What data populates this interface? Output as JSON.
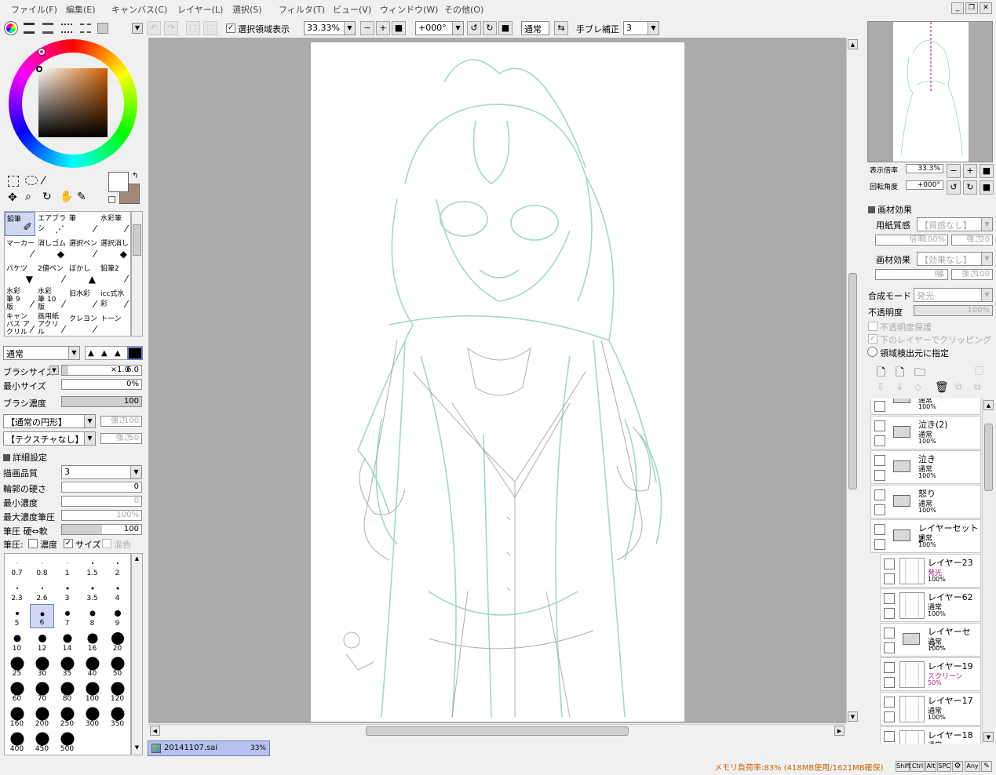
{
  "menu": [
    "ファイル(F)",
    "編集(E)",
    "キャンバス(C)",
    "レイヤー(L)",
    "選択(S)",
    "フィルタ(T)",
    "ビュー(V)",
    "ウィンドウ(W)",
    "その他(O)"
  ],
  "toolbar": {
    "selection_display_label": "選択領域表示",
    "zoom_value": "33.33%",
    "rotation_value": "+000°",
    "blend_mode": "通常",
    "stabilizer_label": "手ブレ補正",
    "stabilizer_value": "3"
  },
  "tools": {
    "row1": [
      "鉛筆",
      "エアブラシ",
      "筆",
      "水彩筆"
    ],
    "row2": [
      "マーカー",
      "消しゴム",
      "選択ペン",
      "選択消し"
    ],
    "row3": [
      "バケツ",
      "2値ペン",
      "ぼかし",
      "鉛筆2"
    ],
    "row4": [
      "水彩筆 9版",
      "水彩筆 10版",
      "旧水彩",
      "icc式水彩"
    ],
    "row5": [
      "キャンバス アクリル",
      "画用紙 アクリル",
      "クレヨン",
      "トーン"
    ]
  },
  "brush": {
    "mode": "通常",
    "size_label": "ブラシサイズ",
    "size_mult": "×1.0",
    "size_value": "6.0",
    "min_size_label": "最小サイズ",
    "min_size_value": "0%",
    "density_label": "ブラシ濃度",
    "density_value": "100",
    "shape": "【通常の円形】",
    "shape_strength_label": "強さ",
    "shape_strength_value": "100",
    "texture": "【テクスチャなし】",
    "texture_strength_label": "強さ",
    "texture_strength_value": "50"
  },
  "details": {
    "header": "詳細設定",
    "quality_label": "描画品質",
    "quality_value": "3",
    "edge_label": "輪郭の硬さ",
    "edge_value": "0",
    "min_density_label": "最小濃度",
    "min_density_value": "0",
    "max_density_pressure_label": "最大濃度筆圧",
    "max_density_pressure_value": "100%",
    "pressure_label": "筆圧 硬⇔軟",
    "pressure_value": "100",
    "pressure_row_label": "筆圧:",
    "pressure_density": "濃度",
    "pressure_size": "サイズ",
    "pressure_blend": "混色"
  },
  "brush_sizes": [
    "0.7",
    "0.8",
    "1",
    "1.5",
    "2",
    "2.3",
    "2.6",
    "3",
    "3.5",
    "4",
    "5",
    "6",
    "7",
    "8",
    "9",
    "10",
    "12",
    "14",
    "16",
    "20",
    "25",
    "30",
    "35",
    "40",
    "50",
    "60",
    "70",
    "80",
    "100",
    "120",
    "160",
    "200",
    "250",
    "300",
    "350",
    "400",
    "450",
    "500"
  ],
  "selected_brush_size": "6",
  "document_tab": {
    "name": "20141107.sai",
    "zoom": "33%"
  },
  "navigator": {
    "zoom_label": "表示倍率",
    "zoom_value": "33.3%",
    "rotate_label": "回転角度",
    "rotate_value": "+000°"
  },
  "material": {
    "header": "画材効果",
    "paper_label": "用紙質感",
    "paper_value": "【質感なし】",
    "magnif_label": "倍率",
    "magnif_value": "100%",
    "paper_strength_label": "強さ",
    "paper_strength_value": "20",
    "effect_label": "画材効果",
    "effect_value": "【効果なし】",
    "width_label": "幅",
    "width_value": "1",
    "effect_strength_label": "強さ",
    "effect_strength_value": "100"
  },
  "layer_props": {
    "blend_label": "合成モード",
    "blend_value": "発光",
    "opacity_label": "不透明度",
    "opacity_value": "100%",
    "protect_label": "不透明度保護",
    "clip_label": "下のレイヤーでクリッピング",
    "source_label": "領域検出元に指定"
  },
  "layers": [
    {
      "name": "",
      "mode": "通常",
      "opacity": "100%",
      "type": "folder",
      "indent": false
    },
    {
      "name": "泣き(2)",
      "mode": "通常",
      "opacity": "100%",
      "type": "folder",
      "indent": false
    },
    {
      "name": "泣き",
      "mode": "通常",
      "opacity": "100%",
      "type": "folder",
      "indent": false
    },
    {
      "name": "怒り",
      "mode": "通常",
      "opacity": "100%",
      "type": "folder",
      "indent": false
    },
    {
      "name": "レイヤーセット2",
      "mode": "通常",
      "opacity": "100%",
      "type": "folder-open",
      "indent": false
    },
    {
      "name": "レイヤー23",
      "mode": "発光",
      "opacity": "100%",
      "type": "layer",
      "indent": true
    },
    {
      "name": "レイヤー62",
      "mode": "通常",
      "opacity": "100%",
      "type": "layer",
      "indent": true
    },
    {
      "name": "レイヤーセッ...",
      "mode": "通常",
      "opacity": "100%",
      "type": "folder",
      "indent": true
    },
    {
      "name": "レイヤー19",
      "mode": "スクリーン",
      "opacity": "50%",
      "type": "layer",
      "indent": true
    },
    {
      "name": "レイヤー17",
      "mode": "通常",
      "opacity": "100%",
      "type": "layer",
      "indent": true
    },
    {
      "name": "レイヤー18",
      "mode": "通常",
      "opacity": "",
      "type": "layer",
      "indent": true
    }
  ],
  "status": {
    "memory": "メモリ負荷率:83% (418MB使用/1621MB確保)",
    "keys": [
      "Shift",
      "Ctrl",
      "Alt",
      "SPC",
      "Any"
    ]
  },
  "colors": {
    "primary": "#ffffff",
    "secondary": "#a08878",
    "sketch_green": "#7fcfaa",
    "sketch_gray": "#999999",
    "accent_selection": "#6b7fc0",
    "status_text": "#c86400"
  }
}
